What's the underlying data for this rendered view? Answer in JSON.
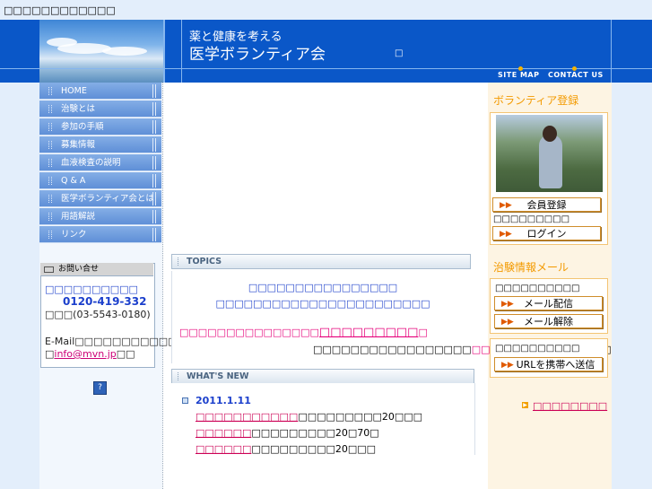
{
  "top_caption": "□□□□□□□□□□□□",
  "header": {
    "tagline": "薬と健康を考える",
    "title": "医学ボランティア会",
    "glyph": "□",
    "sitemap": "SITE MAP",
    "contact": "CONTACT US"
  },
  "nav": [
    {
      "label": "HOME"
    },
    {
      "label": "治験とは"
    },
    {
      "label": "参加の手順"
    },
    {
      "label": "募集情報"
    },
    {
      "label": "血液検査の説明"
    },
    {
      "label": "Q & A"
    },
    {
      "label": "医学ボランティア会とは"
    },
    {
      "label": "用語解説"
    },
    {
      "label": "リンク"
    }
  ],
  "contact": {
    "heading": "お問い合せ",
    "name": "□□□□□□□□□□",
    "phone": "0120-419-332",
    "fax": "□□□(03-5543-0180)",
    "email_label": "E-Mail□□□□□□□□□□□",
    "email_prefix": "□",
    "email_link": "info@mvn.jp",
    "email_suffix": "□□"
  },
  "topics": {
    "heading": "TOPICS",
    "line1": "□□□□□□□□□□□□□□□□",
    "line2": "□□□□□□□□□□□□□□□□□□□□□□□",
    "pink_text": "□□□□□□□□□□□□□□□",
    "pink_big": "□□□□□□□□□",
    "pink_end": "□",
    "black_a": "□□□□□□□□□□□□□□□□□",
    "black_pink": "□□",
    "black_b": "□□□□□□□□□□□□□"
  },
  "whats_new": {
    "heading": "WHAT'S NEW",
    "date": "2011.1.11",
    "items": [
      {
        "link": "□□□□□□□□□□□",
        "text": "□□□□□□□□□20□□□"
      },
      {
        "link": "□□□□□□",
        "text": "□□□□□□□□□20□70□"
      },
      {
        "link": "□□□□□□",
        "text": "□□□□□□□□□20□□□"
      }
    ]
  },
  "sidebar": {
    "volunteer_title": "ボランティア登録",
    "member_button": "会員登録",
    "login_note": "□□□□□□□□□",
    "login_button": "ログイン",
    "mail_title": "治験情報メール",
    "mail_note": "□□□□□□□□□□",
    "mail_subscribe": "メール配信",
    "mail_unsubscribe": "メール解除",
    "mobile_note": "□□□□□□□□□□",
    "mobile_button": "URLを携帯へ送信",
    "extra_link": "□□□□□□□□"
  },
  "colors": {
    "header_blue": "#0a57c8",
    "accent_orange": "#f39a00",
    "link_pink": "#cc0055",
    "link_blue": "#2244cc"
  },
  "icons": {
    "arrow": "double-arrow-icon",
    "mail": "mail-icon",
    "help": "help-icon"
  }
}
